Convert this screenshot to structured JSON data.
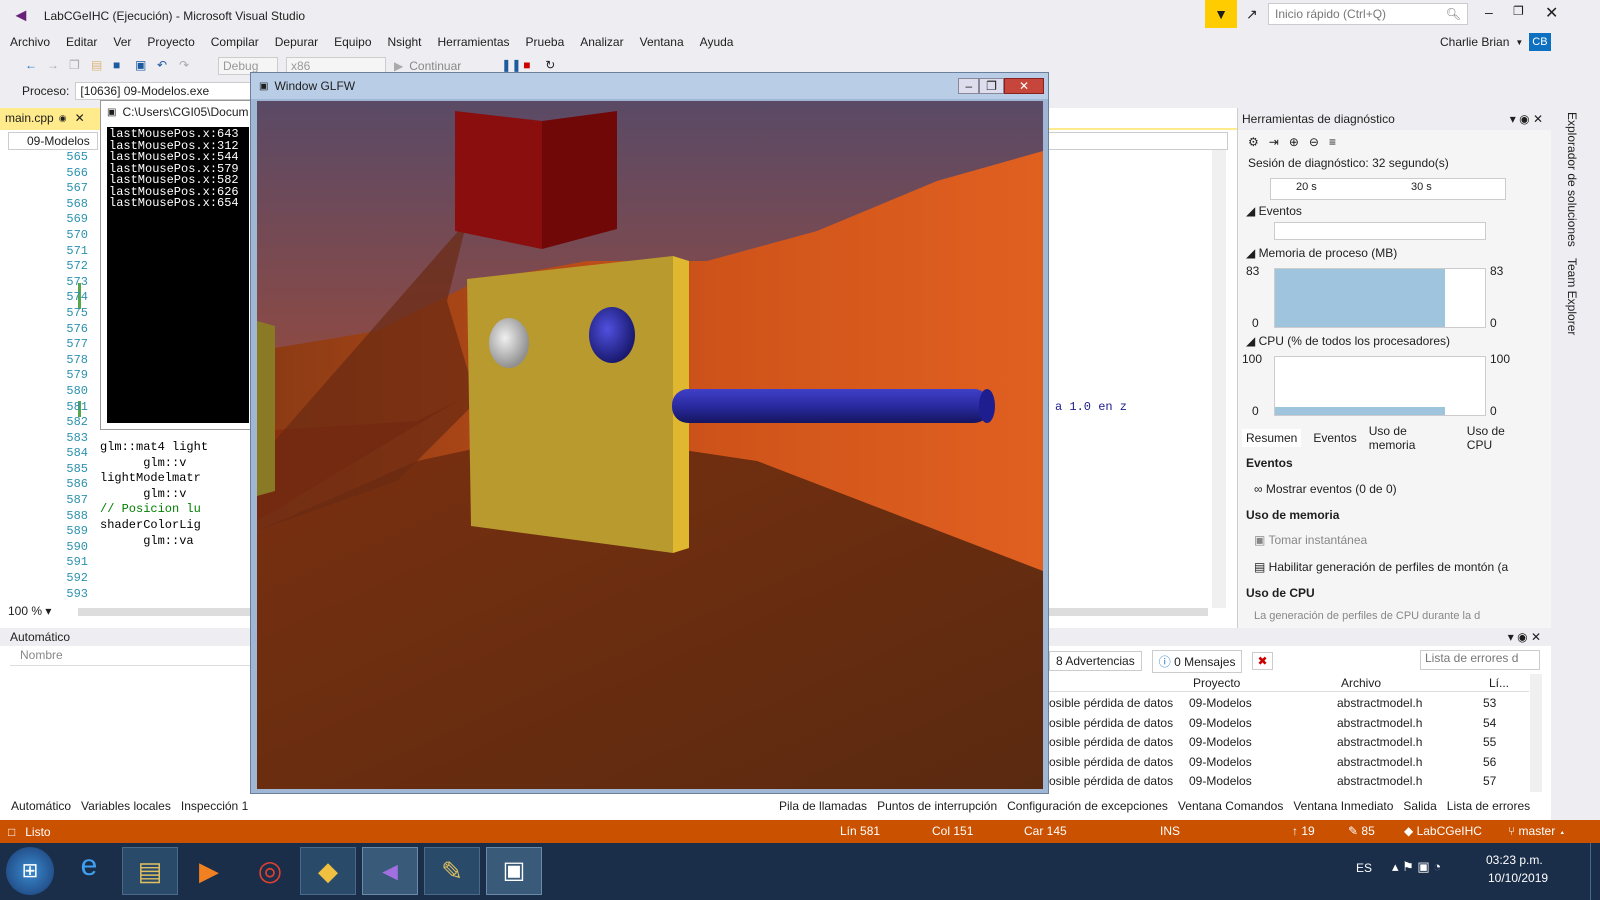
{
  "titlebar": {
    "title": "LabCGeIHC (Ejecución) - Microsoft Visual Studio",
    "quick_launch_placeholder": "Inicio rápido (Ctrl+Q)",
    "user": "Charlie Brian",
    "avatar": "CB"
  },
  "menu": [
    "Archivo",
    "Editar",
    "Ver",
    "Proyecto",
    "Compilar",
    "Depurar",
    "Equipo",
    "Nsight",
    "Herramientas",
    "Prueba",
    "Analizar",
    "Ventana",
    "Ayuda"
  ],
  "toolbar": {
    "config": "Debug",
    "platform": "x86",
    "continue": "Continuar"
  },
  "process": {
    "label": "Proceso:",
    "value": "[10636] 09-Modelos.exe"
  },
  "editor": {
    "tab": "main.cpp",
    "nav": "09-Modelos",
    "zoom": "100 %",
    "line_numbers": [
      "565",
      "566",
      "567",
      "568",
      "569",
      "570",
      "571",
      "572",
      "573",
      "574",
      "575",
      "576",
      "577",
      "578",
      "579",
      "580",
      "581",
      "582",
      "583",
      "584",
      "585",
      "586",
      "587",
      "588",
      "589",
      "590",
      "591",
      "592",
      "593"
    ],
    "code_lines": [
      "glm::mat4 light",
      "      glm::v",
      "lightModelmatr",
      "      glm::v",
      "// Posicion lu",
      "shaderColorLig",
      "      glm::va"
    ],
    "comment_frag": "a 1.0 en z"
  },
  "console": {
    "title": "C:\\Users\\CGI05\\Docum",
    "lines": [
      "lastMousePos.x:643",
      "lastMousePos.x:312",
      "lastMousePos.x:544",
      "lastMousePos.x:579",
      "lastMousePos.x:582",
      "lastMousePos.x:626",
      "lastMousePos.x:654"
    ]
  },
  "glfw": {
    "title": "Window GLFW"
  },
  "diag": {
    "title": "Herramientas de diagnóstico",
    "session": "Sesión de diagnóstico: 32 segundo(s)",
    "t1": "20 s",
    "t2": "30 s",
    "events": "Eventos",
    "memory": "Memoria de proceso (MB)",
    "mem_max": "83",
    "mem_min": "0",
    "cpu": "CPU (% de todos los procesadores)",
    "cpu_max": "100",
    "cpu_min": "0",
    "tabs": [
      "Resumen",
      "Eventos",
      "Uso de memoria",
      "Uso de CPU"
    ],
    "sec_events": "Eventos",
    "show_events": "Mostrar eventos (0 de 0)",
    "sec_mem": "Uso de memoria",
    "snapshot": "Tomar instantánea",
    "heap": "Habilitar generación de perfiles de montón (a",
    "sec_cpu": "Uso de CPU",
    "cpu_note": "La generación de perfiles de CPU durante la d"
  },
  "side_tabs": [
    "Explorador de soluciones",
    "Team Explorer"
  ],
  "auto": {
    "title": "Automático",
    "col_name": "Nombre"
  },
  "errors": {
    "warnings": "8 Advertencias",
    "messages": "0 Mensajes",
    "search": "Lista de errores d",
    "cols": [
      "Proyecto",
      "Archivo",
      "Lí..."
    ],
    "rows": [
      {
        "desc": "osible pérdida de datos",
        "proj": "09-Modelos",
        "file": "abstractmodel.h",
        "line": "53"
      },
      {
        "desc": "osible pérdida de datos",
        "proj": "09-Modelos",
        "file": "abstractmodel.h",
        "line": "54"
      },
      {
        "desc": "osible pérdida de datos",
        "proj": "09-Modelos",
        "file": "abstractmodel.h",
        "line": "55"
      },
      {
        "desc": "osible pérdida de datos",
        "proj": "09-Modelos",
        "file": "abstractmodel.h",
        "line": "56"
      },
      {
        "desc": "osible pérdida de datos",
        "proj": "09-Modelos",
        "file": "abstractmodel.h",
        "line": "57"
      }
    ]
  },
  "bottom_tabs_left": [
    "Automático",
    "Variables locales",
    "Inspección 1"
  ],
  "bottom_tabs_right": [
    "Pila de llamadas",
    "Puntos de interrupción",
    "Configuración de excepciones",
    "Ventana Comandos",
    "Ventana Inmediato",
    "Salida",
    "Lista de errores"
  ],
  "status": {
    "ready": "Listo",
    "line": "Lín 581",
    "col": "Col 151",
    "car": "Car 145",
    "ins": "INS",
    "up": "19",
    "edits": "85",
    "repo": "LabCGeIHC",
    "branch": "master"
  },
  "taskbar": {
    "lang": "ES",
    "time": "03:23 p.m.",
    "date": "10/10/2019"
  }
}
